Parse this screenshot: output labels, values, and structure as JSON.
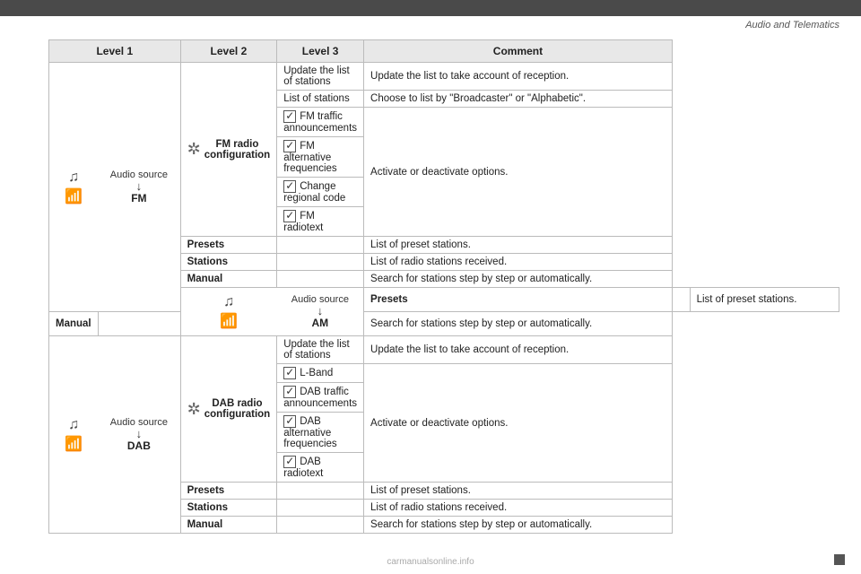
{
  "page": {
    "title": "Audio and Telematics",
    "bottom_watermark": "carmanualsonline.info"
  },
  "table": {
    "headers": [
      "Level 1",
      "Level 2",
      "Level 3",
      "Comment"
    ],
    "sections": [
      {
        "id": "fm",
        "l1_label": "Audio source",
        "l1_sublabel": "FM",
        "l2_entries": [
          {
            "label": "FM radio configuration",
            "has_star": true,
            "l3_entries": [
              {
                "checkbox": false,
                "text": "Update the list of stations",
                "comment": "Update the list to take account of reception."
              },
              {
                "checkbox": false,
                "text": "List of stations",
                "comment": "Choose to list by \"Broadcaster\" or \"Alphabetic\"."
              },
              {
                "checkbox": true,
                "text": "FM traffic announcements",
                "comment": "Activate or deactivate options."
              },
              {
                "checkbox": true,
                "text": "FM alternative frequencies",
                "comment": ""
              },
              {
                "checkbox": true,
                "text": "Change regional code",
                "comment": ""
              },
              {
                "checkbox": true,
                "text": "FM radiotext",
                "comment": ""
              }
            ]
          },
          {
            "label": "Presets",
            "has_star": false,
            "l3_entries": [],
            "comment": "List of preset stations."
          },
          {
            "label": "Stations",
            "has_star": false,
            "l3_entries": [],
            "comment": "List of radio stations received."
          },
          {
            "label": "Manual",
            "has_star": false,
            "l3_entries": [],
            "comment": "Search for stations step by step or automatically."
          }
        ]
      },
      {
        "id": "am",
        "l1_label": "Audio source",
        "l1_sublabel": "AM",
        "l2_entries": [
          {
            "label": "Presets",
            "has_star": false,
            "l3_entries": [],
            "comment": "List of preset stations."
          },
          {
            "label": "Manual",
            "has_star": false,
            "l3_entries": [],
            "comment": "Search for stations step by step or automatically."
          }
        ]
      },
      {
        "id": "dab",
        "l1_label": "Audio source",
        "l1_sublabel": "DAB",
        "l2_entries": [
          {
            "label": "DAB radio configuration",
            "has_star": true,
            "l3_entries": [
              {
                "checkbox": false,
                "text": "Update the list of stations",
                "comment": "Update the list to take account of reception."
              },
              {
                "checkbox": true,
                "text": "L-Band",
                "comment": "Activate or deactivate options."
              },
              {
                "checkbox": true,
                "text": "DAB traffic announcements",
                "comment": ""
              },
              {
                "checkbox": true,
                "text": "DAB alternative frequencies",
                "comment": ""
              },
              {
                "checkbox": true,
                "text": "DAB radiotext",
                "comment": ""
              }
            ]
          },
          {
            "label": "Presets",
            "has_star": false,
            "l3_entries": [],
            "comment": "List of preset stations."
          },
          {
            "label": "Stations",
            "has_star": false,
            "l3_entries": [],
            "comment": "List of radio stations received."
          },
          {
            "label": "Manual",
            "has_star": false,
            "l3_entries": [],
            "comment": "Search for stations step by step or automatically."
          }
        ]
      }
    ]
  }
}
